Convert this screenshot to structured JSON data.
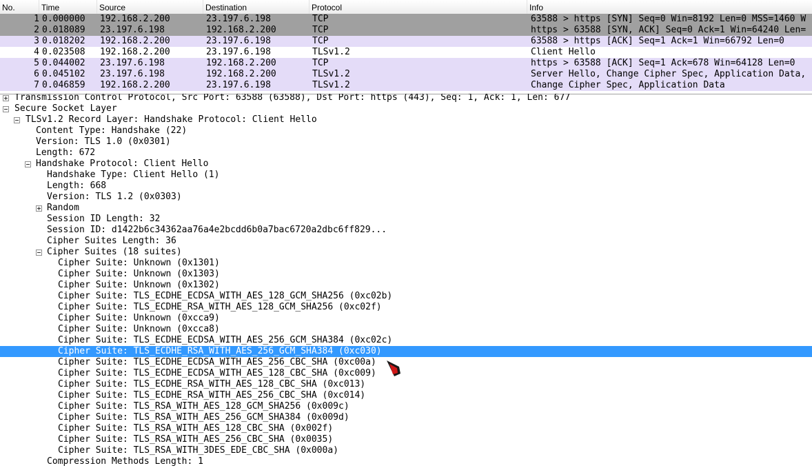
{
  "packet_list": {
    "headers": [
      "No.",
      "Time",
      "Source",
      "Destination",
      "Protocol",
      "Info"
    ],
    "row_colors": {
      "tcp_handshake": "#a0a0a0",
      "tcp": "#e4dcf8",
      "tls": "#e4dcf8"
    },
    "rows": [
      {
        "no": "1",
        "time": "0.000000",
        "src": "192.168.2.200",
        "dst": "23.197.6.198",
        "proto": "TCP",
        "info": "63588 > https [SYN] Seq=0 Win=8192 Len=0 MSS=1460 W",
        "color": "#a0a0a0"
      },
      {
        "no": "2",
        "time": "0.018089",
        "src": "23.197.6.198",
        "dst": "192.168.2.200",
        "proto": "TCP",
        "info": "https > 63588 [SYN, ACK] Seq=0 Ack=1 Win=64240 Len=",
        "color": "#a0a0a0"
      },
      {
        "no": "3",
        "time": "0.018202",
        "src": "192.168.2.200",
        "dst": "23.197.6.198",
        "proto": "TCP",
        "info": "63588 > https [ACK] Seq=1 Ack=1 Win=66792 Len=0",
        "color": "#e4dcf8"
      },
      {
        "no": "4",
        "time": "0.023508",
        "src": "192.168.2.200",
        "dst": "23.197.6.198",
        "proto": "TLSv1.2",
        "info": "Client Hello",
        "color": "#ffffff"
      },
      {
        "no": "5",
        "time": "0.044002",
        "src": "23.197.6.198",
        "dst": "192.168.2.200",
        "proto": "TCP",
        "info": "https > 63588 [ACK] Seq=1 Ack=678 Win=64128 Len=0",
        "color": "#e4dcf8"
      },
      {
        "no": "6",
        "time": "0.045102",
        "src": "23.197.6.198",
        "dst": "192.168.2.200",
        "proto": "TLSv1.2",
        "info": "Server Hello, Change Cipher Spec, Application Data,",
        "color": "#e4dcf8"
      },
      {
        "no": "7",
        "time": "0.046859",
        "src": "192.168.2.200",
        "dst": "23.197.6.198",
        "proto": "TLSv1.2",
        "info": "Change Cipher Spec, Application Data",
        "color": "#e4dcf8"
      }
    ]
  },
  "detail_tree": {
    "selection_color": "#3399ff",
    "rows": [
      {
        "text": "Transmission Control Protocol, Src Port: 63588 (63588), Dst Port: https (443), Seq: 1, Ack: 1, Len: 677",
        "level": 0,
        "toggle": "plus"
      },
      {
        "text": "Secure Socket Layer",
        "level": 0,
        "toggle": "minus"
      },
      {
        "text": "TLSv1.2 Record Layer: Handshake Protocol: Client Hello",
        "level": 1,
        "toggle": "minus"
      },
      {
        "text": "Content Type: Handshake (22)",
        "level": 2
      },
      {
        "text": "Version: TLS 1.0 (0x0301)",
        "level": 2
      },
      {
        "text": "Length: 672",
        "level": 2
      },
      {
        "text": "Handshake Protocol: Client Hello",
        "level": 2,
        "toggle": "minus"
      },
      {
        "text": "Handshake Type: Client Hello (1)",
        "level": 3
      },
      {
        "text": "Length: 668",
        "level": 3
      },
      {
        "text": "Version: TLS 1.2 (0x0303)",
        "level": 3
      },
      {
        "text": "Random",
        "level": 3,
        "toggle": "plus"
      },
      {
        "text": "Session ID Length: 32",
        "level": 3
      },
      {
        "text": "Session ID: d1422b6c34362aa76a4e2bcdd6b0a7bac6720a2dbc6ff829...",
        "level": 3
      },
      {
        "text": "Cipher Suites Length: 36",
        "level": 3
      },
      {
        "text": "Cipher Suites (18 suites)",
        "level": 3,
        "toggle": "minus"
      },
      {
        "text": "Cipher Suite: Unknown (0x1301)",
        "level": 4
      },
      {
        "text": "Cipher Suite: Unknown (0x1303)",
        "level": 4
      },
      {
        "text": "Cipher Suite: Unknown (0x1302)",
        "level": 4
      },
      {
        "text": "Cipher Suite: TLS_ECDHE_ECDSA_WITH_AES_128_GCM_SHA256 (0xc02b)",
        "level": 4
      },
      {
        "text": "Cipher Suite: TLS_ECDHE_RSA_WITH_AES_128_GCM_SHA256 (0xc02f)",
        "level": 4
      },
      {
        "text": "Cipher Suite: Unknown (0xcca9)",
        "level": 4
      },
      {
        "text": "Cipher Suite: Unknown (0xcca8)",
        "level": 4
      },
      {
        "text": "Cipher Suite: TLS_ECDHE_ECDSA_WITH_AES_256_GCM_SHA384 (0xc02c)",
        "level": 4
      },
      {
        "text": "Cipher Suite: TLS_ECDHE_RSA_WITH_AES_256_GCM_SHA384 (0xc030)",
        "level": 4,
        "selected": true
      },
      {
        "text": "Cipher Suite: TLS_ECDHE_ECDSA_WITH_AES_256_CBC_SHA (0xc00a)",
        "level": 4
      },
      {
        "text": "Cipher Suite: TLS_ECDHE_ECDSA_WITH_AES_128_CBC_SHA (0xc009)",
        "level": 4
      },
      {
        "text": "Cipher Suite: TLS_ECDHE_RSA_WITH_AES_128_CBC_SHA (0xc013)",
        "level": 4
      },
      {
        "text": "Cipher Suite: TLS_ECDHE_RSA_WITH_AES_256_CBC_SHA (0xc014)",
        "level": 4
      },
      {
        "text": "Cipher Suite: TLS_RSA_WITH_AES_128_GCM_SHA256 (0x009c)",
        "level": 4
      },
      {
        "text": "Cipher Suite: TLS_RSA_WITH_AES_256_GCM_SHA384 (0x009d)",
        "level": 4
      },
      {
        "text": "Cipher Suite: TLS_RSA_WITH_AES_128_CBC_SHA (0x002f)",
        "level": 4
      },
      {
        "text": "Cipher Suite: TLS_RSA_WITH_AES_256_CBC_SHA (0x0035)",
        "level": 4
      },
      {
        "text": "Cipher Suite: TLS_RSA_WITH_3DES_EDE_CBC_SHA (0x000a)",
        "level": 4
      },
      {
        "text": "Compression Methods Length: 1",
        "level": 3
      }
    ]
  },
  "cursor": {
    "icon": "mouse-pointer-icon"
  }
}
